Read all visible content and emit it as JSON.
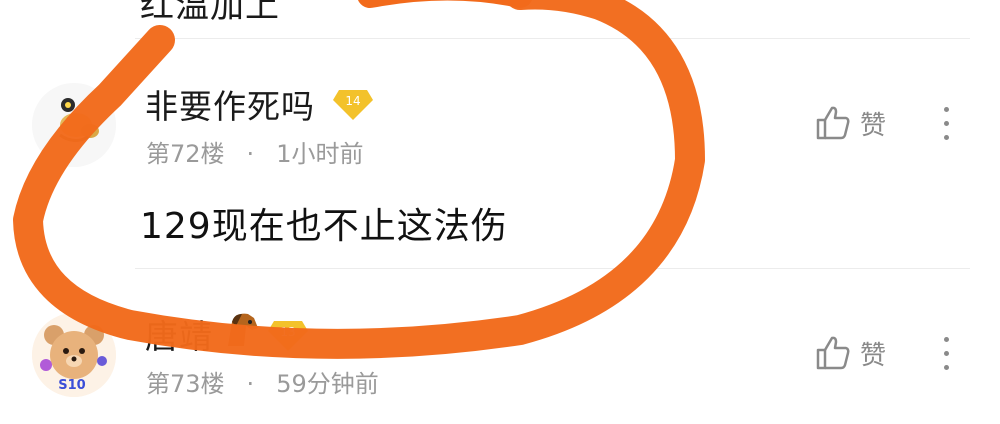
{
  "partial_top_text": "红温加上",
  "comments": [
    {
      "username": "非要作死吗",
      "level": "14",
      "floor": "第72楼",
      "separator": "·",
      "time": "1小时前",
      "text": "129现在也不止这法伤",
      "like_label": "赞"
    },
    {
      "username": "唐靖",
      "level": "13",
      "floor": "第73楼",
      "separator": "·",
      "time": "59分钟前",
      "like_label": "赞",
      "avatar_badge": "S10"
    }
  ],
  "colors": {
    "annotation_stroke": "#F26A1B",
    "level_badge_fill": "#F3C22B",
    "muted_text": "#9A9A9A"
  }
}
